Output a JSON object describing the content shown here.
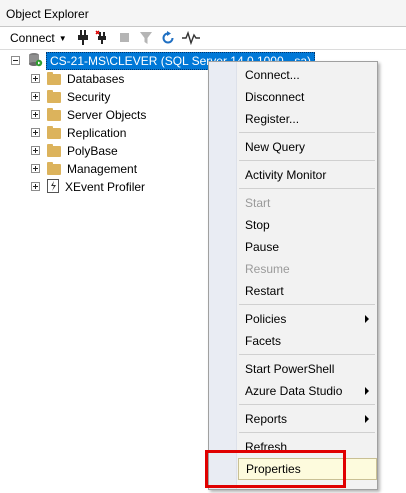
{
  "window": {
    "title": "Object Explorer"
  },
  "toolbar": {
    "connect_label": "Connect"
  },
  "tree": {
    "server_label": "CS-21-MS\\CLEVER (SQL Server 14.0.1000 - sa)",
    "items": [
      {
        "label": "Databases"
      },
      {
        "label": "Security"
      },
      {
        "label": "Server Objects"
      },
      {
        "label": "Replication"
      },
      {
        "label": "PolyBase"
      },
      {
        "label": "Management"
      },
      {
        "label": "XEvent Profiler"
      }
    ]
  },
  "context_menu": {
    "items": [
      {
        "label": "Connect...",
        "enabled": true
      },
      {
        "label": "Disconnect",
        "enabled": true
      },
      {
        "label": "Register...",
        "enabled": true
      },
      {
        "label": "New Query",
        "enabled": true
      },
      {
        "label": "Activity Monitor",
        "enabled": true
      },
      {
        "label": "Start",
        "enabled": false
      },
      {
        "label": "Stop",
        "enabled": true
      },
      {
        "label": "Pause",
        "enabled": true
      },
      {
        "label": "Resume",
        "enabled": false
      },
      {
        "label": "Restart",
        "enabled": true
      },
      {
        "label": "Policies",
        "enabled": true,
        "submenu": true
      },
      {
        "label": "Facets",
        "enabled": true
      },
      {
        "label": "Start PowerShell",
        "enabled": true
      },
      {
        "label": "Azure Data Studio",
        "enabled": true,
        "submenu": true
      },
      {
        "label": "Reports",
        "enabled": true,
        "submenu": true
      },
      {
        "label": "Refresh",
        "enabled": true
      },
      {
        "label": "Properties",
        "enabled": true,
        "highlighted": true
      }
    ]
  },
  "colors": {
    "selection": "#0078d7",
    "menu_hover": "#fdfbdd",
    "annotation_red": "#e00000",
    "folder": "#dcb35c"
  }
}
